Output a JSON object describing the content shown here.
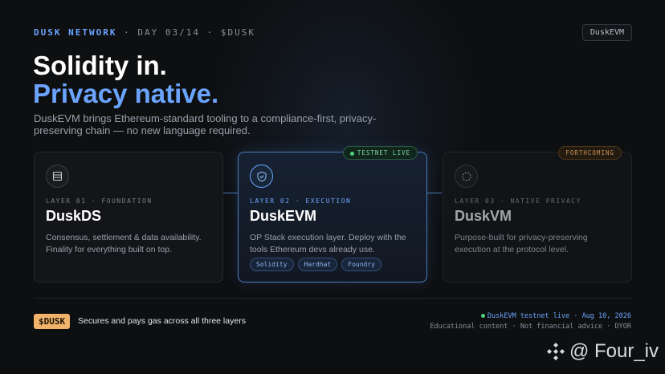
{
  "header": {
    "brand": "DUSK NETWORK",
    "separator": "·",
    "day": "DAY 03/14",
    "ticker": "$DUSK",
    "badge": "DuskEVM"
  },
  "hero": {
    "line1": "Solidity in.",
    "line2": "Privacy native.",
    "subtitle": "DuskEVM brings Ethereum-standard tooling to a compliance-first, privacy-preserving chain — no new language required."
  },
  "cards": [
    {
      "icon": "layers-icon",
      "layer": "LAYER 01 · FOUNDATION",
      "title": "DuskDS",
      "desc": "Consensus, settlement & data availability. Finality for everything built on top."
    },
    {
      "icon": "shield-check-icon",
      "layer": "LAYER 02 · EXECUTION",
      "title": "DuskEVM",
      "desc": "OP Stack execution layer. Deploy with the tools Ethereum devs already use.",
      "pill": "TESTNET LIVE",
      "tags": [
        "Solidity",
        "Hardhat",
        "Foundry"
      ]
    },
    {
      "icon": "dashed-circle-icon",
      "layer": "LAYER 03 · NATIVE PRIVACY",
      "title": "DuskVM",
      "desc": "Purpose-built for privacy-preserving execution at the protocol level.",
      "pill": "FORTHCOMING"
    }
  ],
  "footer": {
    "token": "$DUSK",
    "token_desc": "Secures and pays gas across all three layers",
    "status": "DuskEVM testnet live · Aug 10, 2026",
    "disclaimer": "Educational content · Not financial advice · DYOR"
  },
  "watermark": {
    "handle": "@ Four_iv"
  },
  "colors": {
    "accent": "#6ba4ff",
    "token": "#f1b26a",
    "live": "#4fd07f",
    "background": "#0e0f11"
  }
}
